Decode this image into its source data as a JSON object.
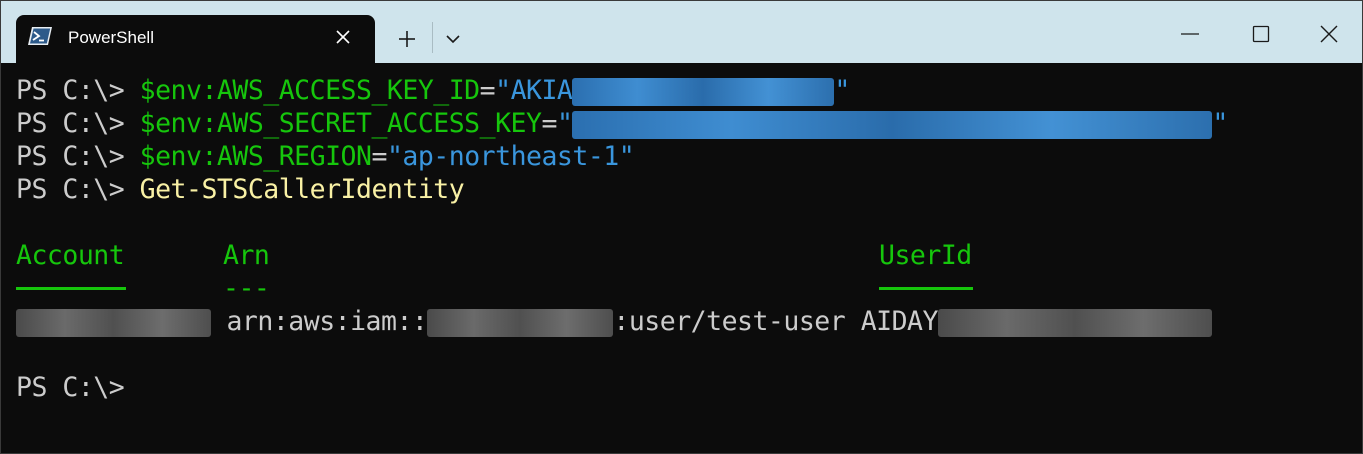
{
  "tab": {
    "title": "PowerShell"
  },
  "terminal": {
    "prompt": "PS C:\\> ",
    "lines": [
      {
        "var": "$env:AWS_ACCESS_KEY_ID",
        "eq": "=",
        "val_start": "\"AKIA",
        "val_end": "\""
      },
      {
        "var": "$env:AWS_SECRET_ACCESS_KEY",
        "eq": "=",
        "val_start": "\"",
        "val_end": "\""
      },
      {
        "var": "$env:AWS_REGION",
        "eq": "=",
        "val": "\"ap-northeast-1\""
      },
      {
        "cmd": "Get-STSCallerIdentity"
      }
    ],
    "headers": {
      "account": "Account",
      "arn": "Arn",
      "arn_dashes": "---",
      "userid": "UserId"
    },
    "row": {
      "arn_prefix": "arn:aws:iam::",
      "arn_suffix": ":user/test-user",
      "userid_prefix": "AIDAY"
    },
    "final_prompt": "PS C:\\>"
  },
  "colors": {
    "tab_bar": "#cfe4ec",
    "background": "#0c0c0c",
    "green": "#16c60c",
    "blue": "#3a96dd",
    "yellow": "#f9f1a5"
  },
  "icons": [
    "powershell-icon",
    "close-icon",
    "plus-icon",
    "chevron-down-icon",
    "minimize-icon",
    "maximize-icon",
    "window-close-icon"
  ]
}
